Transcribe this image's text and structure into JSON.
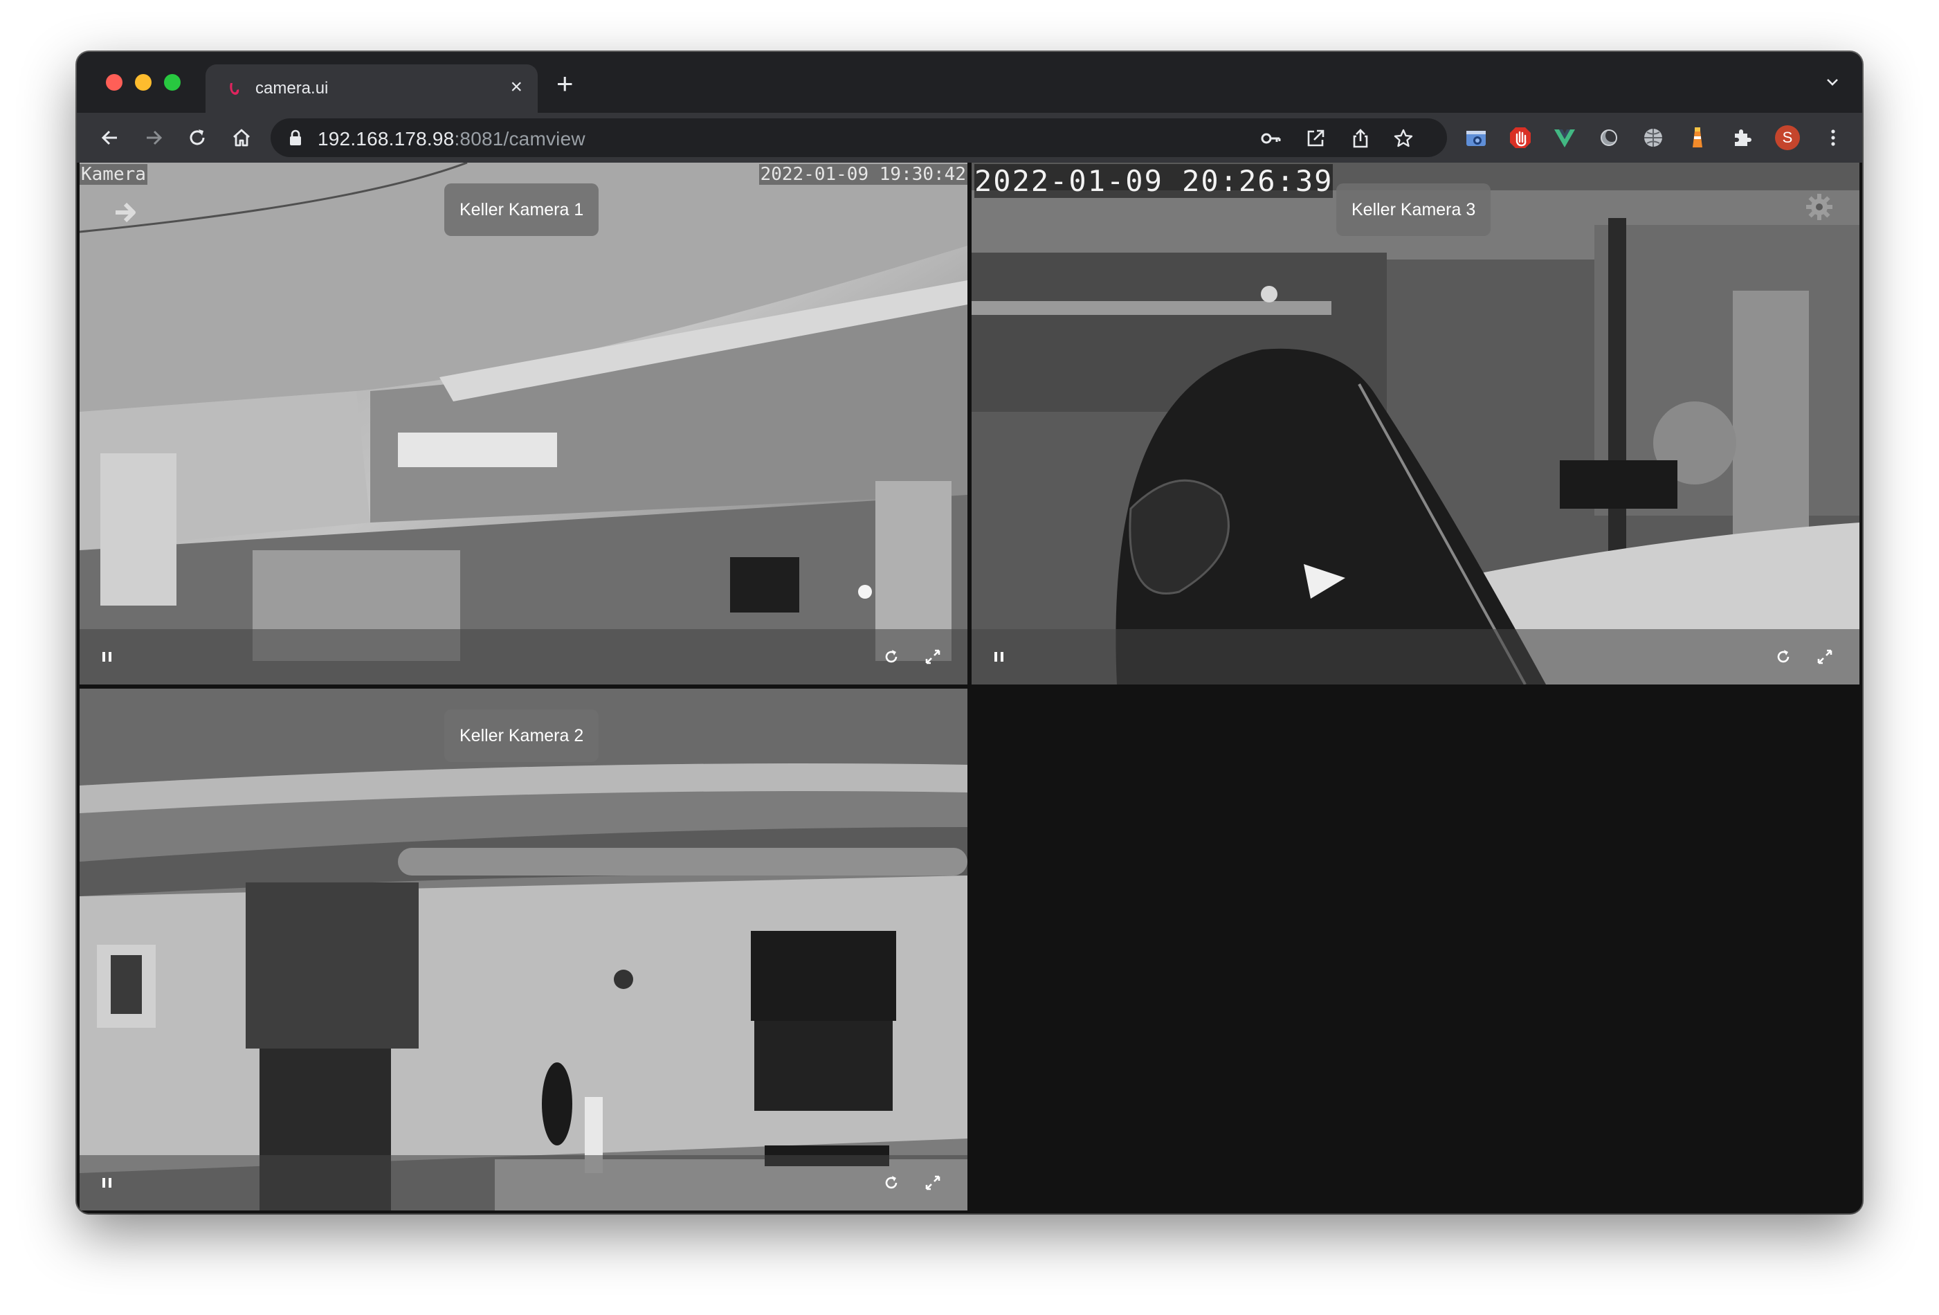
{
  "browser": {
    "tab": {
      "title": "camera.ui",
      "close_glyph": "×"
    },
    "new_tab_glyph": "+",
    "url": {
      "host": "192.168.178.98",
      "rest": ":8081/camview"
    },
    "profile_initial": "S",
    "colors": {
      "frame": "#202124",
      "toolbar": "#35363a",
      "accent": "#e8eaed"
    }
  },
  "cameras": [
    {
      "name": "Keller Kamera 1",
      "osd_left": "Kamera",
      "osd_time": "2022-01-09 19:30:42"
    },
    {
      "name": "Keller Kamera 3",
      "osd_time": "2022-01-09  20:26:39"
    },
    {
      "name": "Keller Kamera 2"
    }
  ],
  "icons": {
    "back": "back-arrow-icon",
    "forward": "forward-arrow-icon",
    "reload": "reload-icon",
    "home": "home-icon",
    "lock": "lock-icon",
    "key": "key-icon",
    "open": "open-in-window-icon",
    "share": "share-icon",
    "star": "bookmark-star-icon",
    "pause": "pause-icon",
    "refresh": "refresh-icon",
    "fullscreen": "fullscreen-icon",
    "settings": "gear-icon"
  }
}
